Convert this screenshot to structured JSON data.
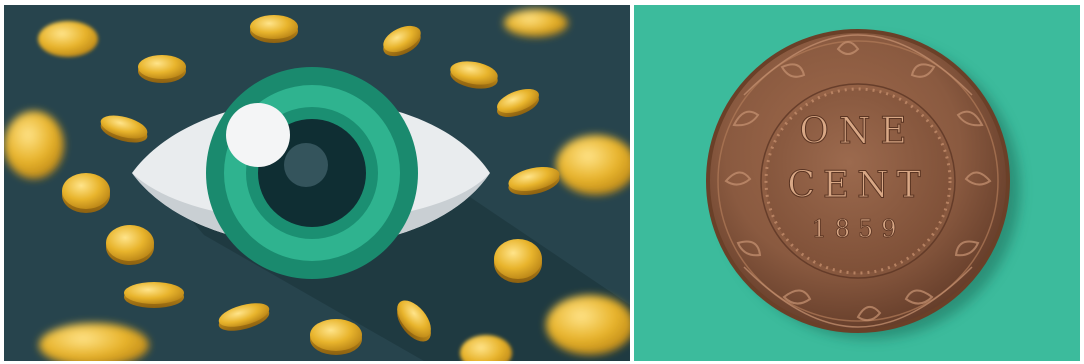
{
  "image": {
    "left_panel": {
      "subject": "eye-illustration",
      "background_color": "#27444d",
      "coin_color": "#e6b42a"
    },
    "right_panel": {
      "subject": "coin-photo",
      "background_color": "#3cbb9c",
      "coin": {
        "line1": "ONE",
        "line2": "CENT",
        "year": "1859",
        "metal_color": "#8a5a40"
      }
    }
  }
}
